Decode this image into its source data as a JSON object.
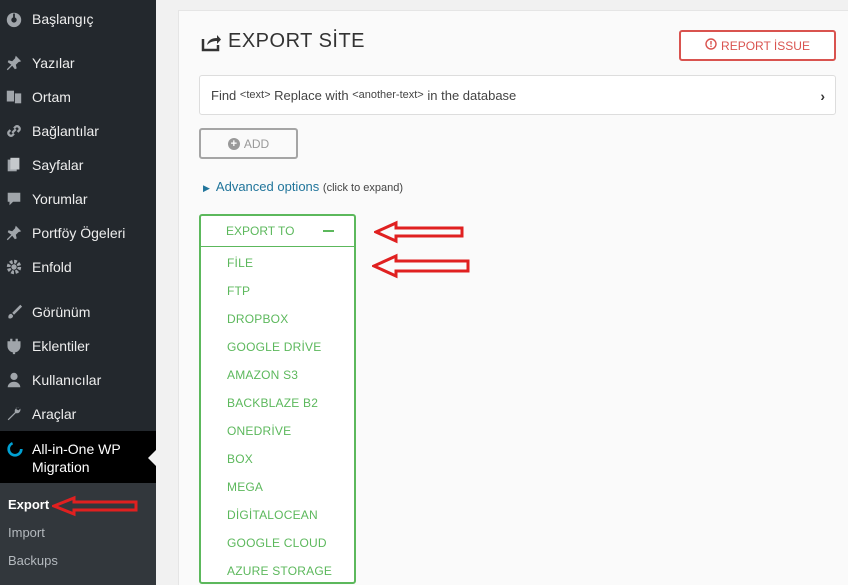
{
  "sidebar": {
    "items": [
      {
        "label": "Başlangıç",
        "icon": "dashboard-icon"
      },
      {
        "label": "Yazılar",
        "icon": "pin-icon"
      },
      {
        "label": "Ortam",
        "icon": "media-icon"
      },
      {
        "label": "Bağlantılar",
        "icon": "link-icon"
      },
      {
        "label": "Sayfalar",
        "icon": "pages-icon"
      },
      {
        "label": "Yorumlar",
        "icon": "comment-icon"
      },
      {
        "label": "Portföy Ögeleri",
        "icon": "pin-icon"
      },
      {
        "label": "Enfold",
        "icon": "gear-icon"
      },
      {
        "label": "Görünüm",
        "icon": "brush-icon"
      },
      {
        "label": "Eklentiler",
        "icon": "plugin-icon"
      },
      {
        "label": "Kullanıcılar",
        "icon": "user-icon"
      },
      {
        "label": "Araçlar",
        "icon": "wrench-icon"
      }
    ],
    "active": {
      "label": "All-in-One WP Migration",
      "icon": "migration-icon"
    },
    "submenu": [
      "Export",
      "Import",
      "Backups"
    ]
  },
  "header": {
    "title": "EXPORT SİTE",
    "report_label": "REPORT İSSUE"
  },
  "find": {
    "prefix": "Find",
    "text_tag": "<text>",
    "middle": "Replace with",
    "another_tag": "<another-text>",
    "suffix": "in the database"
  },
  "add_label": "ADD",
  "advanced": {
    "label": "Advanced options",
    "hint": "(click to expand)"
  },
  "export": {
    "header": "EXPORT TO",
    "items": [
      "FİLE",
      "FTP",
      "DROPBOX",
      "GOOGLE DRİVE",
      "AMAZON S3",
      "BACKBLAZE B2",
      "ONEDRİVE",
      "BOX",
      "MEGA",
      "DİGİTALOCEAN",
      "GOOGLE CLOUD",
      "AZURE STORAGE"
    ]
  },
  "colors": {
    "sidebar": "#23282d",
    "accent_green": "#5cb85c",
    "report_red": "#d9534f",
    "link_blue": "#21759b",
    "annotation_red": "#e02020"
  }
}
